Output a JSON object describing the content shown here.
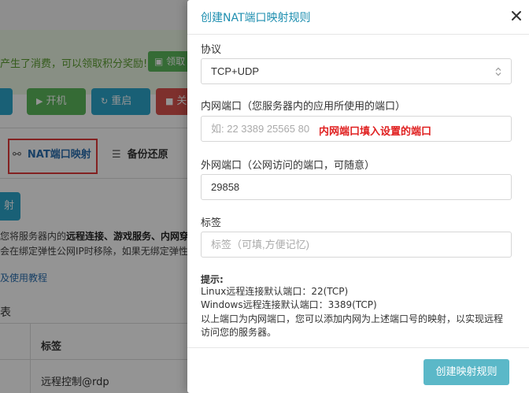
{
  "background": {
    "notice_text": "产生了消费，可以领取积分奖励!",
    "gift_button": "领取",
    "actions": {
      "power_on": "开机",
      "restart": "重启",
      "power_off": "关"
    },
    "tabs": {
      "nat": "NAT端口映射",
      "backup": "备份还原"
    },
    "add_button": "射",
    "desc_line1": {
      "pre": "您将服务器内的",
      "bold": "远程连接、游戏服务、内网穿",
      "post": ""
    },
    "desc_line2": "会在绑定弹性公网IP时移除，如果无绑定弹性",
    "help_link": "及使用教程",
    "list_title": "表",
    "table": {
      "header_label": "标签",
      "row_label": "远程控制@rdp"
    }
  },
  "modal": {
    "title": "创建NAT端口映射规则",
    "protocol": {
      "label": "协议",
      "selected": "TCP+UDP"
    },
    "internal_port": {
      "label": "内网端口（您服务器内的应用所使用的端口）",
      "placeholder": "如: 22 3389 25565 80",
      "annotation": "内网端口填入设置的端口"
    },
    "external_port": {
      "label": "外网端口（公网访问的端口，可随意）",
      "value": "29858"
    },
    "tag": {
      "label": "标签",
      "placeholder": "标签（可填,方便记忆)"
    },
    "hints": {
      "title": "提示:",
      "lines": [
        "Linux远程连接默认端口：22(TCP)",
        "Windows远程连接默认端口：3389(TCP)",
        "以上端口为内网端口，您可以添加内网为上述端口号的映射，以实现远程",
        "访问您的服务器。"
      ]
    },
    "submit_button": "创建映射规则"
  },
  "colors": {
    "accent": "#1f8fb0",
    "submit_bg": "#5bb8c8",
    "annotation_red": "#e02020",
    "green": "#5cb85c",
    "blue": "#2ba6cb",
    "red": "#d9534f"
  },
  "icons": [
    "gift-icon",
    "play-icon",
    "refresh-icon",
    "stop-icon",
    "share-icon",
    "database-icon",
    "close-icon",
    "select-arrows-icon"
  ]
}
